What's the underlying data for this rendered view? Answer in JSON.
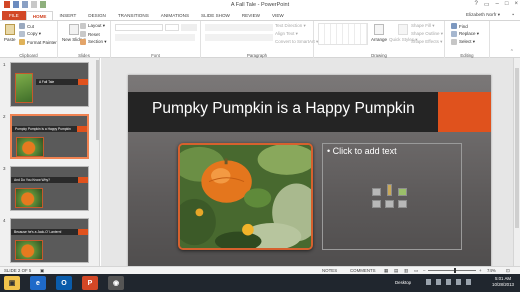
{
  "app": {
    "title": "A Fall Tale - PowerPoint"
  },
  "window_controls": [
    "?",
    "▭",
    "–",
    "□",
    "×"
  ],
  "tabs": [
    {
      "label": "FILE",
      "kind": "file"
    },
    {
      "label": "HOME",
      "kind": "active"
    },
    {
      "label": "INSERT"
    },
    {
      "label": "DESIGN"
    },
    {
      "label": "TRANSITIONS"
    },
    {
      "label": "ANIMATIONS"
    },
    {
      "label": "SLIDE SHOW"
    },
    {
      "label": "REVIEW"
    },
    {
      "label": "VIEW"
    }
  ],
  "user": {
    "name": "Elizabeth Norfr ▾"
  },
  "ribbon": {
    "clipboard": {
      "paste": "Paste",
      "cut": "Cut",
      "copy": "Copy ▾",
      "format_painter": "Format Painter",
      "label": "Clipboard"
    },
    "slides": {
      "new_slide": "New Slide ▾",
      "layout": "Layout ▾",
      "reset": "Reset",
      "section": "Section ▾",
      "label": "Slides"
    },
    "font": {
      "label": "Font"
    },
    "paragraph": {
      "text_direction": "Text Direction ▾",
      "align_text": "Align Text ▾",
      "smartart": "Convert to SmartArt ▾",
      "label": "Paragraph"
    },
    "drawing": {
      "arrange": "Arrange",
      "quick_styles": "Quick Styles ▾",
      "shape_fill": "Shape Fill ▾",
      "shape_outline": "Shape Outline ▾",
      "shape_effects": "Shape Effects ▾",
      "label": "Drawing"
    },
    "editing": {
      "find": "Find",
      "replace": "Replace ▾",
      "select": "Select ▾",
      "label": "Editing"
    }
  },
  "thumbnails": [
    {
      "num": "1",
      "title": "A Fall Tale"
    },
    {
      "num": "2",
      "title": "Pumpky Pumpkin is a Happy Pumpkin"
    },
    {
      "num": "3",
      "title": "And Do You Know Why?"
    },
    {
      "num": "4",
      "title": "Because he's a Jack-O' Lantern!"
    }
  ],
  "slide": {
    "title": "Pumpky Pumpkin is a Happy Pumpkin",
    "placeholder": "• Click to add text"
  },
  "status": {
    "slide_count": "SLIDE 2 OF 5",
    "notes": "NOTES",
    "comments": "COMMENTS",
    "zoom": "74%"
  },
  "taskbar": {
    "desktop": "Desktop",
    "time": "5:01 AM",
    "date": "10/28/2013",
    "apps": [
      "explorer-icon",
      "ie-icon",
      "outlook-icon",
      "powerpoint-icon",
      "camera-icon"
    ]
  },
  "colors": {
    "accent": "#d24726",
    "slide_accent": "#e0521d",
    "taskbar": "#20262e"
  }
}
